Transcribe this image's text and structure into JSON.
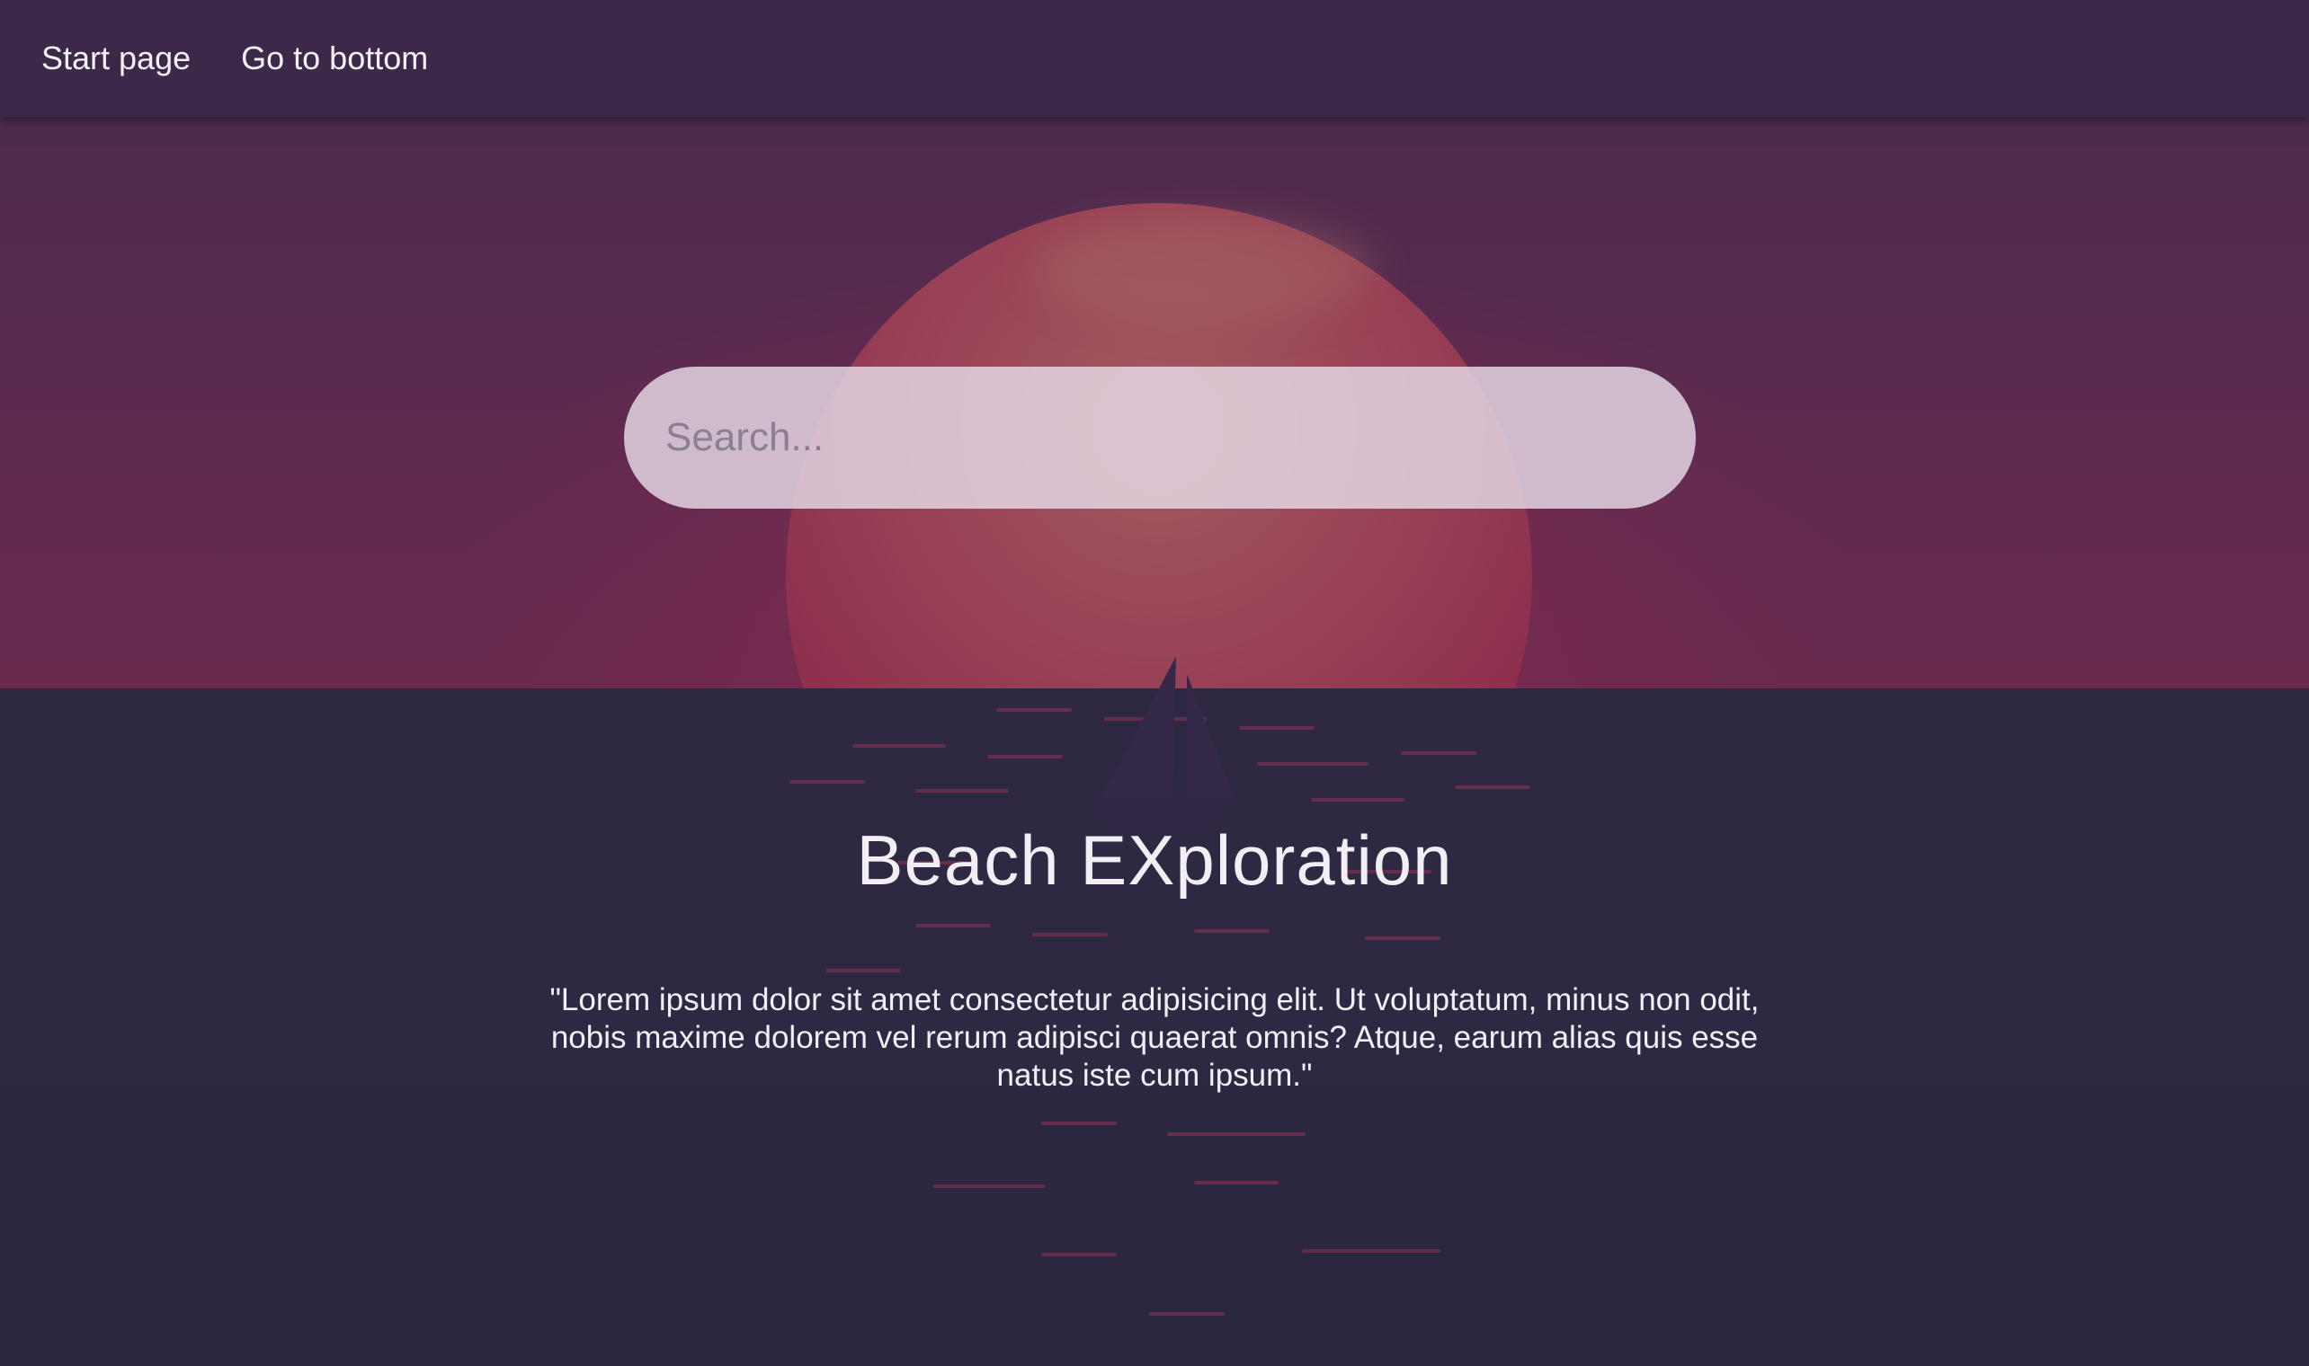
{
  "nav": {
    "start_page": "Start page",
    "go_to_bottom": "Go to bottom"
  },
  "search": {
    "placeholder": "Search..."
  },
  "hero": {
    "title": "Beach EXploration",
    "quote": "\"Lorem ipsum dolor sit amet consectetur adipisicing elit. Ut voluptatum, minus non odit, nobis maxime dolorem vel rerum adipisci quaerat omnis? Atque, earum alias quis esse natus iste cum ipsum.\""
  },
  "colors": {
    "nav_bg": "#3c2848",
    "sky": "#5b2a50",
    "sun": "#8a2b4c",
    "sea": "#2e2842",
    "text": "#f2eef4"
  },
  "icons": {
    "background": "sunset-sailboat-illustration"
  }
}
